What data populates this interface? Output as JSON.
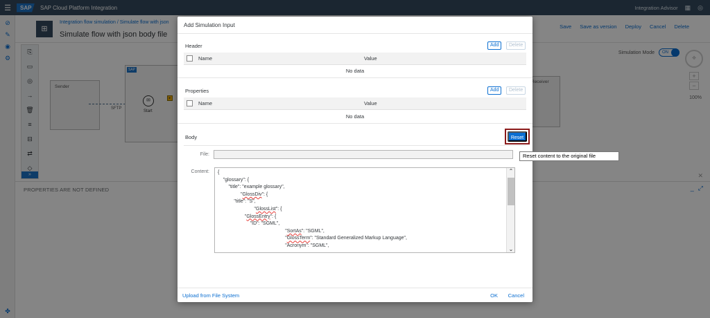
{
  "shell": {
    "logo": "SAP",
    "title": "SAP Cloud Platform Integration",
    "advisor": "Integration Advisor"
  },
  "page": {
    "breadcrumb": "Integration flow simulation / Simulate flow with json",
    "title": "Simulate flow with json body file",
    "actions": [
      "Save",
      "Save as version",
      "Deploy",
      "Cancel",
      "Delete"
    ]
  },
  "canvas": {
    "sender_label": "Sender",
    "receiver_label": "Receiver",
    "adapter_label": "SFTP",
    "start_label": "Start",
    "iflow_tag": "SAP",
    "simulation_mode_label": "Simulation Mode",
    "toggle_label": "ON",
    "zoom_percent": "100%"
  },
  "properties_panel": {
    "title": "PROPERTIES ARE NOT DEFINED"
  },
  "dialog": {
    "title": "Add Simulation Input",
    "header_section": {
      "title": "Header",
      "add_label": "Add",
      "delete_label": "Delete",
      "col_name": "Name",
      "col_value": "Value",
      "empty": "No data"
    },
    "properties_section": {
      "title": "Properties",
      "add_label": "Add",
      "delete_label": "Delete",
      "col_name": "Name",
      "col_value": "Value",
      "empty": "No data"
    },
    "body_section": {
      "title": "Body",
      "reset_label": "Reset",
      "file_label": "File:",
      "file_value": "",
      "content_label": "Content:"
    },
    "footer": {
      "upload_label": "Upload from File System",
      "ok_label": "OK",
      "cancel_label": "Cancel"
    }
  },
  "tooltip": {
    "text": "Reset content to the original file"
  },
  "colors": {
    "shell": "#354a5f",
    "accent": "#0a6ed1",
    "highlight_border": "#8b1a1a"
  }
}
